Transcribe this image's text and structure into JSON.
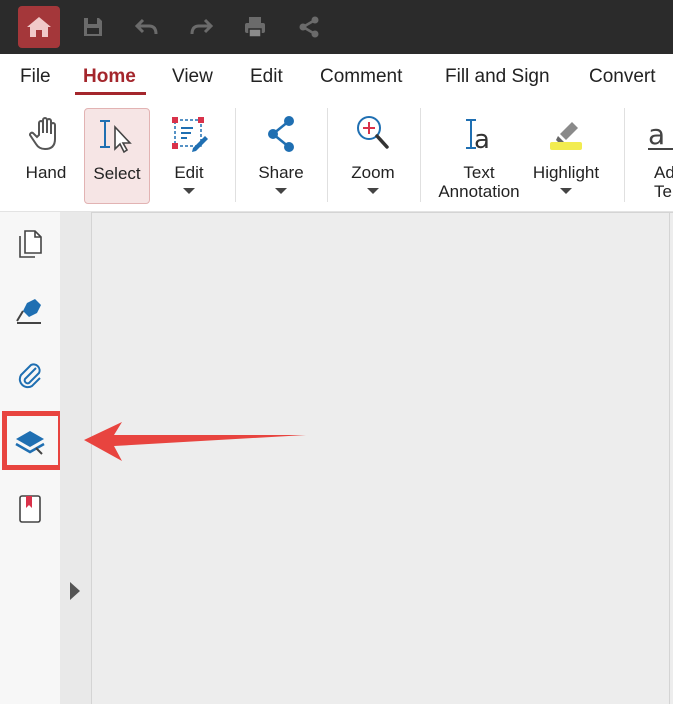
{
  "colors": {
    "titlebar": "#2b2b2b",
    "home_button": "#a4373a",
    "accent": "#a4262c",
    "icon_blue": "#1f6fb2",
    "annotation": "#e8443f"
  },
  "titlebar": {
    "icons": [
      "home-icon",
      "save-icon",
      "undo-icon",
      "redo-icon",
      "print-icon",
      "share-icon"
    ]
  },
  "menu": {
    "tabs": [
      {
        "label": "File"
      },
      {
        "label": "Home"
      },
      {
        "label": "View"
      },
      {
        "label": "Edit"
      },
      {
        "label": "Comment"
      },
      {
        "label": "Fill and Sign"
      },
      {
        "label": "Convert"
      }
    ],
    "active": "Home"
  },
  "ribbon": {
    "hand": {
      "label": "Hand",
      "icon": "hand-icon"
    },
    "select": {
      "label": "Select",
      "icon": "select-cursor-icon"
    },
    "edit": {
      "label": "Edit",
      "icon": "edit-object-icon"
    },
    "share": {
      "label": "Share",
      "icon": "share-icon"
    },
    "zoom": {
      "label": "Zoom",
      "icon": "zoom-in-icon"
    },
    "text_annotation": {
      "label_line1": "Text",
      "label_line2": "Annotation",
      "icon": "text-annotation-icon"
    },
    "highlight": {
      "label": "Highlight",
      "icon": "highlighter-icon"
    },
    "add_text": {
      "label_line1": "Ad",
      "label_line2": "Te",
      "icon": "add-text-icon"
    }
  },
  "sidebar": {
    "items": [
      {
        "name": "pages",
        "icon": "pages-icon"
      },
      {
        "name": "signatures",
        "icon": "signature-pen-icon"
      },
      {
        "name": "attachments",
        "icon": "paperclip-icon"
      },
      {
        "name": "layers",
        "icon": "layers-icon"
      },
      {
        "name": "bookmarks",
        "icon": "bookmark-icon"
      }
    ],
    "highlighted_item": "layers"
  }
}
